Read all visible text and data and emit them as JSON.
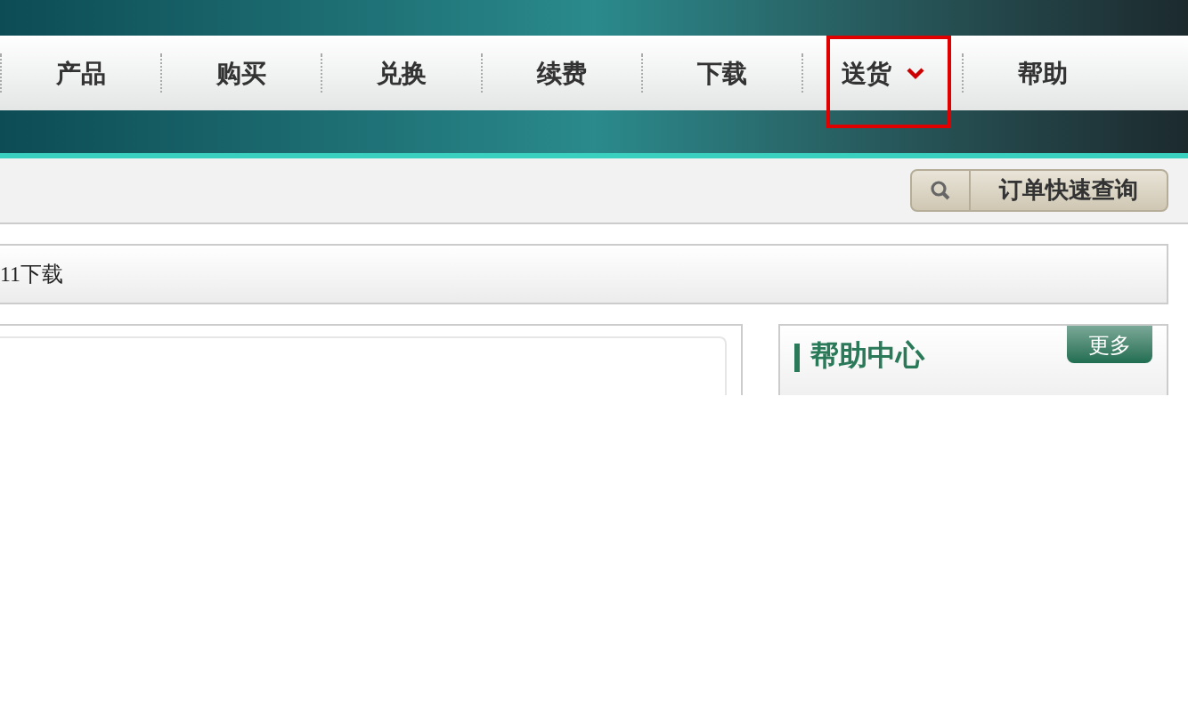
{
  "nav": {
    "items": [
      {
        "label": "产品",
        "highlighted": false,
        "dropdown": false
      },
      {
        "label": "购买",
        "highlighted": false,
        "dropdown": false
      },
      {
        "label": "兑换",
        "highlighted": false,
        "dropdown": false
      },
      {
        "label": "续费",
        "highlighted": false,
        "dropdown": false
      },
      {
        "label": "下载",
        "highlighted": false,
        "dropdown": false
      },
      {
        "label": "送货",
        "highlighted": true,
        "dropdown": true
      },
      {
        "label": "帮助",
        "highlighted": false,
        "dropdown": false
      }
    ]
  },
  "toolbar": {
    "button": "订单快速查询"
  },
  "breadcrumb": "11下载",
  "help_panel": {
    "title": "帮助中心",
    "more": "更多"
  }
}
